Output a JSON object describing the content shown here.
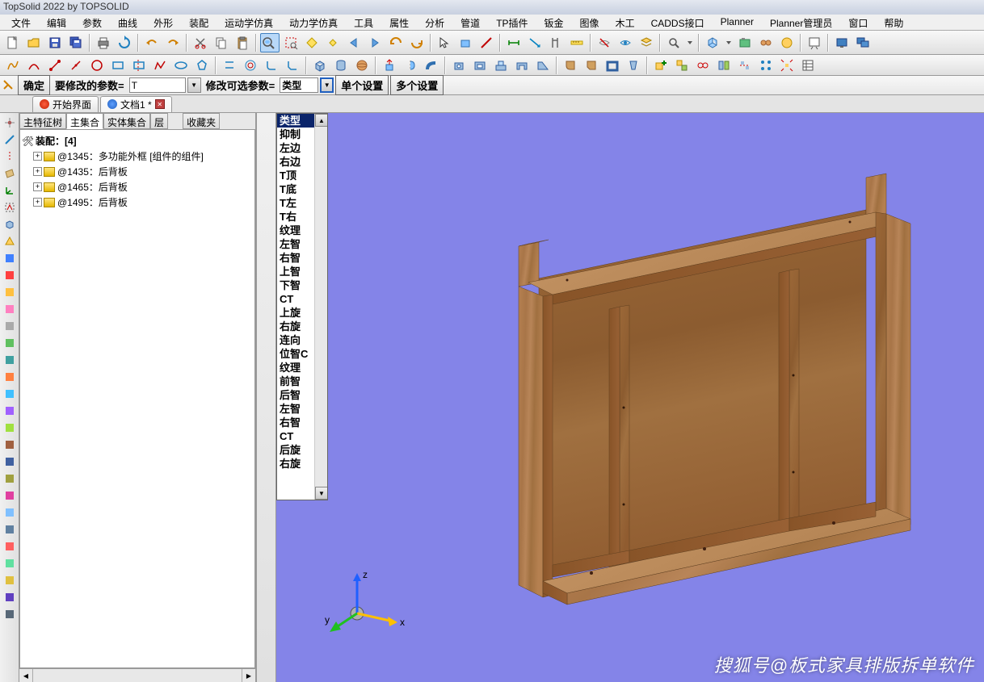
{
  "title": "TopSolid 2022 by TOPSOLID",
  "menu": [
    "文件",
    "编辑",
    "参数",
    "曲线",
    "外形",
    "装配",
    "运动学仿真",
    "动力学仿真",
    "工具",
    "属性",
    "分析",
    "管道",
    "TP插件",
    "钣金",
    "图像",
    "木工",
    "CADDS接口",
    "Planner",
    "Planner管理员",
    "窗口",
    "帮助"
  ],
  "paramBar": {
    "confirm": "确定",
    "modifyLabel": "要修改的参数=",
    "modifyValue": "T",
    "optionalLabel": "修改可选参数=",
    "optionalValue": "类型",
    "singleSetting": "单个设置",
    "multiSetting": "多个设置"
  },
  "docTabs": {
    "start": "开始界面",
    "doc1": "文档1 *"
  },
  "treeTabs": [
    "主特征树",
    "主集合",
    "实体集合",
    "层",
    "收藏夹"
  ],
  "tree": {
    "root": "装配：[4]",
    "items": [
      "@1345：多功能外框 [组件的组件]",
      "@1435：后背板",
      "@1465：后背板",
      "@1495：后背板"
    ]
  },
  "dropdown": [
    "类型",
    "抑制",
    "左边",
    "右边",
    "T顶",
    "T底",
    "T左",
    "T右",
    "纹理",
    "左智",
    "右智",
    "上智",
    "下智",
    "CT",
    "上旋",
    "右旋",
    "连向",
    "位智C",
    "纹理",
    "前智",
    "后智",
    "左智",
    "右智",
    "CT",
    "后旋",
    "右旋"
  ],
  "dropdownSelected": 0,
  "axes": {
    "x": "x",
    "y": "y",
    "z": "z"
  },
  "watermark": "搜狐号@板式家具排版拆单软件"
}
